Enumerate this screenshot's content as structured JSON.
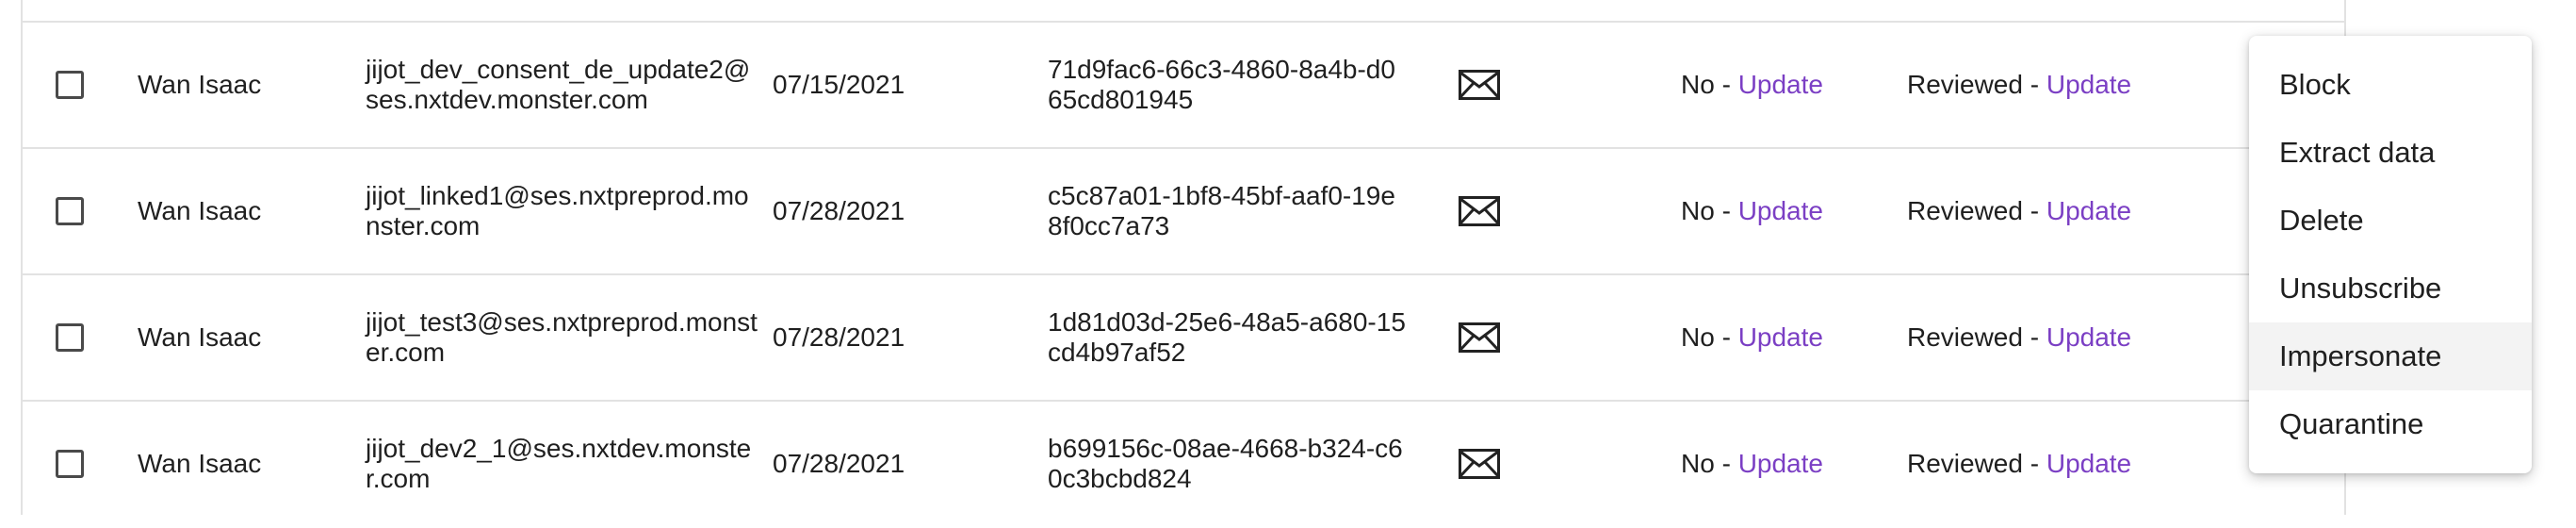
{
  "rows": [
    {
      "name": "Wan Isaac",
      "email": "jijot_dev_consent_de_update2@ses.nxtdev.monster.com",
      "date": "07/15/2021",
      "id": "71d9fac6-66c3-4860-8a4b-d065cd801945",
      "consent_value": "No",
      "consent_link": "Update",
      "review_value": "Reviewed",
      "review_link": "Update",
      "separator": " - "
    },
    {
      "name": "Wan Isaac",
      "email": "jijot_linked1@ses.nxtpreprod.monster.com",
      "date": "07/28/2021",
      "id": "c5c87a01-1bf8-45bf-aaf0-19e8f0cc7a73",
      "consent_value": "No",
      "consent_link": "Update",
      "review_value": "Reviewed",
      "review_link": "Update",
      "separator": " - "
    },
    {
      "name": "Wan Isaac",
      "email": "jijot_test3@ses.nxtpreprod.monster.com",
      "date": "07/28/2021",
      "id": "1d81d03d-25e6-48a5-a680-15cd4b97af52",
      "consent_value": "No",
      "consent_link": "Update",
      "review_value": "Reviewed",
      "review_link": "Update",
      "separator": " - "
    },
    {
      "name": "Wan Isaac",
      "email": "jijot_dev2_1@ses.nxtdev.monster.com",
      "date": "07/28/2021",
      "id": "b699156c-08ae-4668-b324-c60c3bcbd824",
      "consent_value": "No",
      "consent_link": "Update",
      "review_value": "Reviewed",
      "review_link": "Update",
      "separator": " - "
    }
  ],
  "menu": {
    "items": [
      {
        "label": "Block"
      },
      {
        "label": "Extract data"
      },
      {
        "label": "Delete"
      },
      {
        "label": "Unsubscribe"
      },
      {
        "label": "Impersonate"
      },
      {
        "label": "Quarantine"
      }
    ],
    "highlighted": "Impersonate"
  },
  "icons": {
    "mail": "envelope-icon",
    "checkbox": "checkbox-unchecked"
  },
  "colors": {
    "link": "#7b3fc4",
    "border": "#e2e2e2",
    "hover": "#f3f3f3"
  }
}
